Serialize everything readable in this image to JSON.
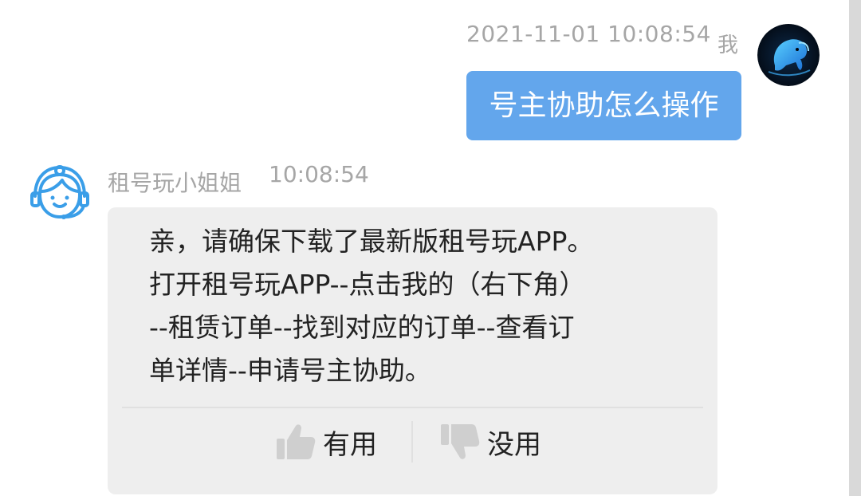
{
  "outgoing": {
    "timestamp": "2021-11-01 10:08:54",
    "sender_label": "我",
    "message": "号主协助怎么操作"
  },
  "incoming": {
    "agent_name": "租号玩小姐姐",
    "time": "10:08:54",
    "lines": [
      "亲，请确保下载了最新版租号玩APP。",
      "打开租号玩APP--点击我的（右下角）",
      "--租赁订单--找到对应的订单--查看订",
      "单详情--申请号主协助。"
    ],
    "feedback": {
      "useful_label": "有用",
      "useless_label": "没用"
    }
  },
  "icons": {
    "user_avatar": "elephant-logo-icon",
    "agent_avatar": "customer-service-headset-icon",
    "useful": "thumbs-up-icon",
    "useless": "thumbs-down-icon"
  },
  "colors": {
    "outgoing_bubble": "#63a6ec",
    "incoming_bubble": "#eeeeee",
    "agent_icon": "#3a9ee8",
    "meta_text": "#a6a6a6"
  }
}
